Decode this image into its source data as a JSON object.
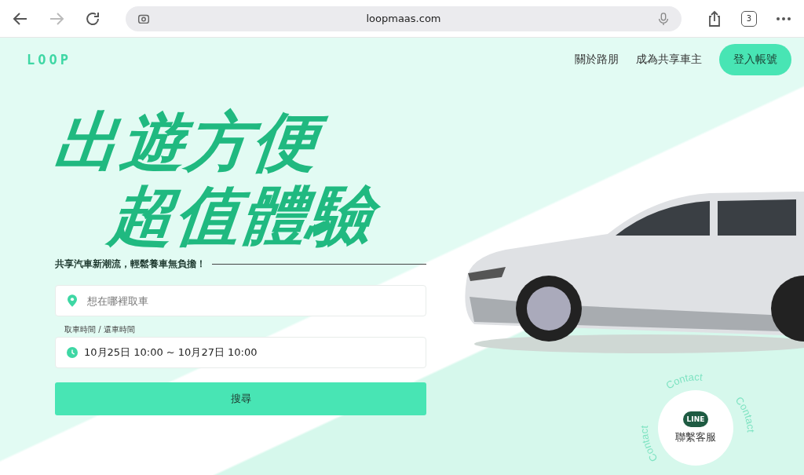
{
  "browser": {
    "url": "loopmaas.com",
    "tab_count": "3"
  },
  "nav": {
    "logo": "LOOP",
    "links": [
      "關於路朋",
      "成為共享車主"
    ],
    "login_button": "登入帳號"
  },
  "hero": {
    "headline_lines": [
      "出遊方便",
      "超值體驗"
    ],
    "tagline": "共享汽車新潮流，輕鬆養車無負擔！"
  },
  "search_form": {
    "location_placeholder": "想在哪裡取車",
    "time_label": "取車時間 / 還車時間",
    "time_value": "10月25日 10:00 ~ 10月27日 10:00",
    "submit_button": "搜尋"
  },
  "contact": {
    "badge": "LINE",
    "label": "聯繫客服",
    "ring_texts": [
      "Contact",
      "Contact",
      "Contact"
    ]
  }
}
